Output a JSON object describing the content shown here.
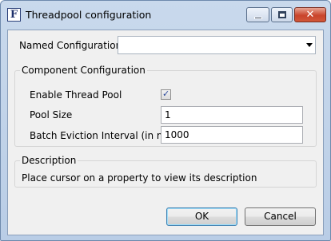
{
  "window": {
    "title": "Threadpool configuration",
    "app_icon_letter": "F",
    "close_glyph": "✕"
  },
  "named_configuration": {
    "label": "Named Configuration",
    "value": ""
  },
  "component_configuration": {
    "legend": "Component Configuration",
    "enable_thread_pool": {
      "label": "Enable Thread Pool",
      "checked": true,
      "check_glyph": "✓"
    },
    "pool_size": {
      "label": "Pool Size",
      "value": "1"
    },
    "batch_eviction_interval": {
      "label": "Batch Eviction Interval (in ms)",
      "value": "1000"
    }
  },
  "description": {
    "legend": "Description",
    "text": "Place cursor on a property to view its description"
  },
  "buttons": {
    "ok": "OK",
    "cancel": "Cancel"
  }
}
